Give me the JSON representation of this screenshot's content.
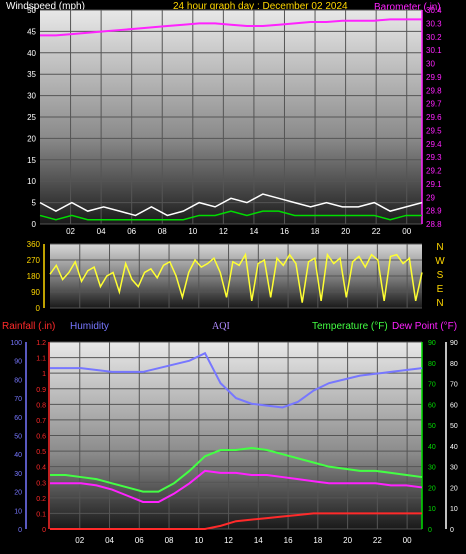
{
  "colors": {
    "background": "#000000",
    "white": "#ffffff",
    "gold": "#ffd700",
    "magenta": "#ff22ff",
    "green": "#00dd00",
    "yellow": "#ffff33",
    "red": "#ff2a2a",
    "blue": "#7777ff",
    "purple": "#b08cff",
    "lime": "#44ff44"
  },
  "header": {
    "windspeed_label": "Windspeed (mph)",
    "date_title": "24 hour graph day : December 02 2024",
    "barometer_label": "Barometer (.in)"
  },
  "direction_labels": [
    "N",
    "W",
    "S",
    "E",
    "N"
  ],
  "legend": {
    "rainfall": "Rainfall (.in)",
    "humidity": "Humidity",
    "aqi": "AQI",
    "temperature": "Temperature (°F)",
    "dewpoint": "Dew Point (°F)"
  },
  "chart_data": [
    {
      "type": "line",
      "name": "wind-barometer",
      "x_ticks": [
        "02",
        "04",
        "06",
        "08",
        "10",
        "12",
        "14",
        "16",
        "18",
        "20",
        "22",
        "00"
      ],
      "y_left_ticks": [
        "0",
        "5",
        "10",
        "15",
        "20",
        "25",
        "30",
        "35",
        "40",
        "45",
        "50"
      ],
      "y_left_range": [
        0,
        50
      ],
      "y_right_ticks": [
        "28.8",
        "28.9",
        "29",
        "29.1",
        "29.2",
        "29.3",
        "29.4",
        "29.5",
        "29.6",
        "29.7",
        "29.8",
        "29.9",
        "30",
        "30.1",
        "30.2",
        "30.3",
        "30.4"
      ],
      "y_right_range": [
        28.8,
        30.4
      ],
      "x": [
        0,
        1,
        2,
        3,
        4,
        5,
        6,
        7,
        8,
        9,
        10,
        11,
        12,
        13,
        14,
        15,
        16,
        17,
        18,
        19,
        20,
        21,
        22,
        23,
        24
      ],
      "series": [
        {
          "key": "barometer",
          "values": [
            30.21,
            30.21,
            30.22,
            30.23,
            30.24,
            30.25,
            30.26,
            30.27,
            30.28,
            30.29,
            30.3,
            30.3,
            30.29,
            30.28,
            30.28,
            30.29,
            30.3,
            30.31,
            30.31,
            30.32,
            30.32,
            30.32,
            30.33,
            30.33,
            30.33
          ]
        },
        {
          "key": "gust",
          "values": [
            5,
            3,
            5,
            3,
            4,
            3,
            2,
            4,
            2,
            3,
            5,
            4,
            6,
            5,
            7,
            6,
            5,
            4,
            5,
            4,
            4,
            5,
            3,
            4,
            5
          ]
        },
        {
          "key": "wind_speed",
          "values": [
            2,
            1,
            2,
            1,
            1,
            1,
            1,
            1,
            1,
            1,
            2,
            2,
            3,
            2,
            3,
            3,
            2,
            2,
            2,
            2,
            2,
            2,
            1,
            2,
            2
          ]
        }
      ]
    },
    {
      "type": "line",
      "name": "wind-direction",
      "x_ticks": [
        "02",
        "04",
        "06",
        "08",
        "10",
        "12",
        "14",
        "16",
        "18",
        "20",
        "22",
        "00"
      ],
      "y_ticks": [
        "0",
        "90",
        "180",
        "270",
        "360"
      ],
      "y_range": [
        0,
        360
      ],
      "series": [
        {
          "key": "direction",
          "values": [
            190,
            240,
            160,
            200,
            260,
            150,
            210,
            230,
            120,
            180,
            200,
            90,
            250,
            160,
            120,
            200,
            220,
            170,
            240,
            260,
            180,
            60,
            200,
            270,
            230,
            250,
            280,
            200,
            60,
            260,
            240,
            300,
            40,
            250,
            270,
            60,
            280,
            240,
            300,
            250,
            30,
            260,
            280,
            40,
            300,
            250,
            280,
            60,
            260,
            290,
            230,
            300,
            270,
            40,
            290,
            300,
            250,
            280,
            40,
            200
          ]
        }
      ]
    },
    {
      "type": "line",
      "name": "rain-humidity-temperature",
      "x_ticks": [
        "02",
        "04",
        "06",
        "08",
        "10",
        "12",
        "14",
        "16",
        "18",
        "20",
        "22",
        "00"
      ],
      "y_left_ticks": [
        "0",
        "0.1",
        "0.2",
        "0.3",
        "0.4",
        "0.5",
        "0.6",
        "0.7",
        "0.8",
        "0.9",
        "1",
        "1.1",
        "1.2"
      ],
      "y_left_range": [
        0,
        1.2
      ],
      "humidity_ticks": [
        "0",
        "10",
        "20",
        "30",
        "40",
        "50",
        "60",
        "70",
        "80",
        "90",
        "100"
      ],
      "humidity_range": [
        0,
        100
      ],
      "y_right_ticks": [
        "0",
        "10",
        "20",
        "30",
        "40",
        "50",
        "60",
        "70",
        "80",
        "90"
      ],
      "y_right_range": [
        0,
        90
      ],
      "x": [
        0,
        1,
        2,
        3,
        4,
        5,
        6,
        7,
        8,
        9,
        10,
        11,
        12,
        13,
        14,
        15,
        16,
        17,
        18,
        19,
        20,
        21,
        22,
        23,
        24
      ],
      "series": [
        {
          "key": "humidity",
          "values": [
            86,
            86,
            86,
            85,
            84,
            84,
            84,
            86,
            88,
            90,
            94,
            78,
            70,
            67,
            66,
            65,
            68,
            74,
            78,
            80,
            82,
            83,
            84,
            85,
            86
          ]
        },
        {
          "key": "temperature",
          "values": [
            26,
            26,
            25,
            24,
            22,
            20,
            18,
            18,
            22,
            28,
            35,
            38,
            38,
            39,
            38,
            36,
            34,
            32,
            30,
            29,
            28,
            28,
            27,
            26,
            25
          ]
        },
        {
          "key": "dew_point",
          "values": [
            22,
            22,
            22,
            21,
            19,
            16,
            13,
            13,
            17,
            22,
            28,
            27,
            27,
            26,
            26,
            25,
            24,
            23,
            22,
            22,
            22,
            22,
            21,
            21,
            20
          ]
        },
        {
          "key": "rainfall",
          "values": [
            0,
            0,
            0,
            0,
            0,
            0,
            0,
            0,
            0,
            0,
            0,
            0.02,
            0.05,
            0.06,
            0.07,
            0.08,
            0.09,
            0.1,
            0.1,
            0.1,
            0.1,
            0.1,
            0.1,
            0.1,
            0.1
          ]
        }
      ]
    }
  ]
}
